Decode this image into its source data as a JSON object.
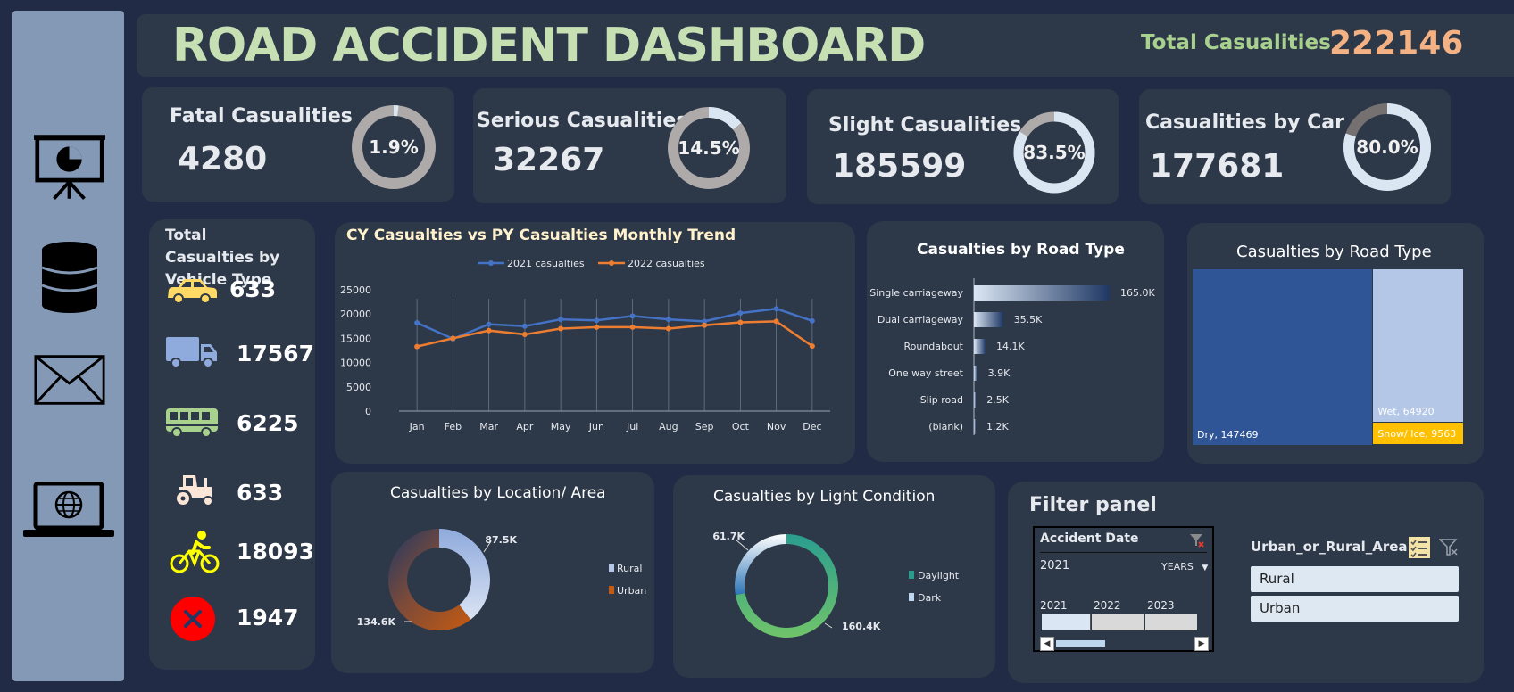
{
  "header": {
    "title": "ROAD ACCIDENT DASHBOARD",
    "total_label": "Total Casualities",
    "total_value": "222146"
  },
  "sidebar": {
    "icons": [
      "presentation-icon",
      "database-icon",
      "mail-icon",
      "web-laptop-icon"
    ]
  },
  "kpis": [
    {
      "title": "Fatal Casualities",
      "value": "4280",
      "pct_label": "1.9%",
      "pct": 1.9,
      "color": "#dbe6f3"
    },
    {
      "title": "Serious Casualities",
      "value": "32267",
      "pct_label": "14.5%",
      "pct": 14.5,
      "color": "#dbe6f3"
    },
    {
      "title": "Slight Casualities",
      "value": "185599",
      "pct_label": "83.5%",
      "pct": 83.5,
      "color": "#dbe6f3"
    },
    {
      "title": "Casualities by Car",
      "value": "177681",
      "pct_label": "80.0%",
      "pct": 80.0,
      "color": "#dbe6f3"
    }
  ],
  "vehicle": {
    "title": "Total Casualties by Vehicle Type",
    "items": [
      {
        "icon": "car-icon",
        "value": "633",
        "color": "#ffd966"
      },
      {
        "icon": "truck-icon",
        "value": "17567",
        "color": "#b4c7e7"
      },
      {
        "icon": "bus-icon",
        "value": "6225",
        "color": "#a9d18e"
      },
      {
        "icon": "tractor-icon",
        "value": "633",
        "color": "#fbe5d6"
      },
      {
        "icon": "bicycle-icon",
        "value": "18093",
        "color": "#ffff00"
      },
      {
        "icon": "other-icon",
        "value": "1947",
        "color": "#ff0000"
      }
    ]
  },
  "trend": {
    "title": "CY Casualties vs PY Casualties Monthly Trend",
    "chart_data": {
      "type": "line",
      "categories": [
        "Jan",
        "Feb",
        "Mar",
        "Apr",
        "May",
        "Jun",
        "Jul",
        "Aug",
        "Sep",
        "Oct",
        "Nov",
        "Dec"
      ],
      "series": [
        {
          "name": "2021 casualties",
          "color": "#4472c4",
          "values": [
            18200,
            14900,
            17900,
            17500,
            18900,
            18700,
            19600,
            18900,
            18500,
            20200,
            21100,
            18600
          ]
        },
        {
          "name": "2022 casualties",
          "color": "#ed7d31",
          "values": [
            13300,
            15000,
            16600,
            15800,
            17000,
            17300,
            17300,
            17000,
            17700,
            18300,
            18500,
            13400
          ]
        }
      ],
      "yticks": [
        "25000",
        "20000",
        "15000",
        "10000",
        "5000",
        "0"
      ],
      "ylim": [
        0,
        25000
      ]
    }
  },
  "road_bar": {
    "title": "Casualties by Road Type",
    "chart_data": {
      "type": "bar",
      "categories": [
        "Single carriageway",
        "Dual carriageway",
        "Roundabout",
        "One way street",
        "Slip road",
        "(blank)"
      ],
      "values": [
        165.0,
        35.5,
        14.1,
        3.9,
        2.5,
        1.2
      ],
      "labels": [
        "165.0K",
        "35.5K",
        "14.1K",
        "3.9K",
        "2.5K",
        "1.2K"
      ]
    }
  },
  "road_tree": {
    "title": "Casualties by Road Type",
    "chart_data": {
      "type": "treemap",
      "items": [
        {
          "label": "Dry, 147469",
          "value": 147469,
          "color": "#2f5597"
        },
        {
          "label": "Wet, 64920",
          "value": 64920,
          "color": "#b4c7e7"
        },
        {
          "label": "Snow/ Ice, 9563",
          "value": 9563,
          "color": "#ffc000"
        }
      ]
    }
  },
  "location": {
    "title": "Casualties by Location/ Area",
    "chart_data": {
      "type": "pie",
      "categories": [
        "Rural",
        "Urban"
      ],
      "values": [
        87.5,
        134.6
      ],
      "labels": [
        "87.5K",
        "134.6K"
      ]
    }
  },
  "light": {
    "title": "Casualties by Light Condition",
    "chart_data": {
      "type": "pie",
      "categories": [
        "Daylight",
        "Dark"
      ],
      "values": [
        160.4,
        61.7
      ],
      "labels": [
        "160.4K",
        "61.7K"
      ]
    }
  },
  "filter": {
    "title": "Filter panel",
    "date_slicer": {
      "title": "Accident Date",
      "selected": "2021",
      "level": "YEARS",
      "years": [
        "2021",
        "2022",
        "2023"
      ]
    },
    "area_slicer": {
      "title": "Urban_or_Rural_Area",
      "options": [
        "Rural",
        "Urban"
      ]
    }
  }
}
